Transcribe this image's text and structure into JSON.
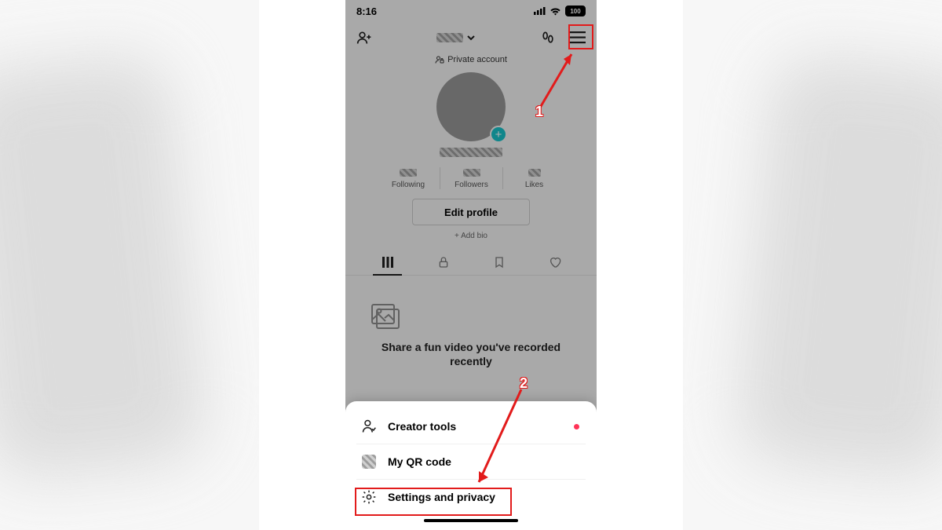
{
  "status": {
    "time": "8:16",
    "battery": "100"
  },
  "header": {
    "account_type": "Private account"
  },
  "stats": {
    "following_label": "Following",
    "followers_label": "Followers",
    "likes_label": "Likes"
  },
  "profile": {
    "edit_label": "Edit profile",
    "add_bio_label": "+ Add bio"
  },
  "empty_state": {
    "caption": "Share a fun video you've recorded recently"
  },
  "sheet": {
    "creator_tools": "Creator tools",
    "qr_code": "My QR code",
    "settings": "Settings and privacy"
  },
  "annotations": {
    "step1": "1",
    "step2": "2"
  }
}
